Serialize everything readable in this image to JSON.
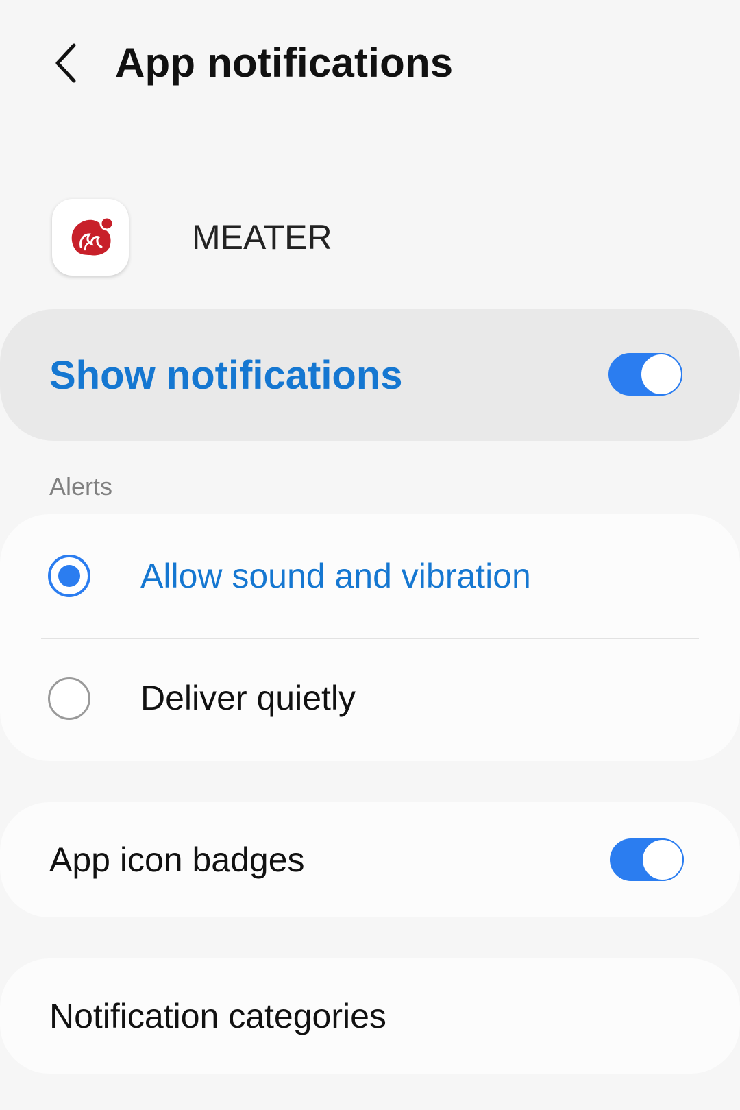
{
  "header": {
    "title": "App notifications",
    "back_icon": "chevron-left-icon"
  },
  "app": {
    "name": "MEATER",
    "icon": "meater-logo-icon",
    "icon_color": "#c8202a"
  },
  "master_switch": {
    "label": "Show notifications",
    "enabled": true
  },
  "alerts": {
    "header": "Alerts",
    "options": [
      {
        "label": "Allow sound and vibration",
        "selected": true
      },
      {
        "label": "Deliver quietly",
        "selected": false
      }
    ]
  },
  "app_icon_badges": {
    "label": "App icon badges",
    "enabled": true
  },
  "notification_categories": {
    "label": "Notification categories"
  },
  "colors": {
    "accent": "#2b7df0",
    "accent_text": "#1577d1",
    "background": "#f6f6f6",
    "card": "#fcfcfc",
    "master_switch_bg": "#e9e9e9"
  }
}
